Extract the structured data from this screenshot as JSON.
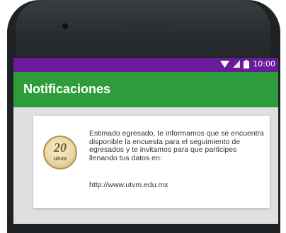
{
  "status_bar": {
    "time": "10:00"
  },
  "app_bar": {
    "title": "Notificaciones"
  },
  "notification": {
    "message": "Estimado egresado, te informamos que se encuentra disponible la encuesta para el seguimiento de egresados y te invitamos para que participes llenando tus datos en:",
    "url": "http://www.utvm.edu.mx",
    "logo": {
      "number": "20",
      "wordmark": "utvm"
    }
  },
  "colors": {
    "status_bar": "#6a1b9a",
    "app_bar": "#2e9c3a",
    "screen_background": "#e0e0e0",
    "card": "#ffffff",
    "phone_frame": "#1f2224"
  },
  "icons": [
    "wifi-icon",
    "signal-icon",
    "battery-icon"
  ]
}
